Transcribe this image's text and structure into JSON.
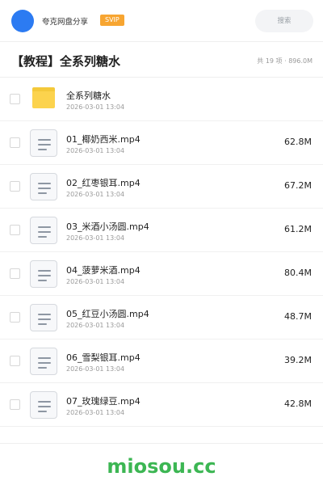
{
  "header": {
    "site_name": "夸克网盘分享",
    "badge": "SVIP",
    "search_placeholder": "搜索"
  },
  "title_bar": {
    "title": "【教程】全系列糖水",
    "summary": "共 19 项 · 896.0M"
  },
  "folder": {
    "name": "全系列糖水",
    "date": "2026-03-01 13:04"
  },
  "files": [
    {
      "name": "01_椰奶西米.mp4",
      "date": "2026-03-01 13:04",
      "size": "62.8M"
    },
    {
      "name": "02_红枣银耳.mp4",
      "date": "2026-03-01 13:04",
      "size": "67.2M"
    },
    {
      "name": "03_米酒小汤圆.mp4",
      "date": "2026-03-01 13:04",
      "size": "61.2M"
    },
    {
      "name": "04_菠萝米酒.mp4",
      "date": "2026-03-01 13:04",
      "size": "80.4M"
    },
    {
      "name": "05_红豆小汤圆.mp4",
      "date": "2026-03-01 13:04",
      "size": "48.7M"
    },
    {
      "name": "06_雪梨银耳.mp4",
      "date": "2026-03-01 13:04",
      "size": "39.2M"
    },
    {
      "name": "07_玫瑰绿豆.mp4",
      "date": "2026-03-01 13:04",
      "size": "42.8M"
    }
  ],
  "footer": {
    "watermark": "miosou.cc"
  },
  "colors": {
    "accent": "#2c7bf2",
    "badge": "#f7a531",
    "folder": "#fcd34d",
    "watermark": "#3cb653"
  }
}
